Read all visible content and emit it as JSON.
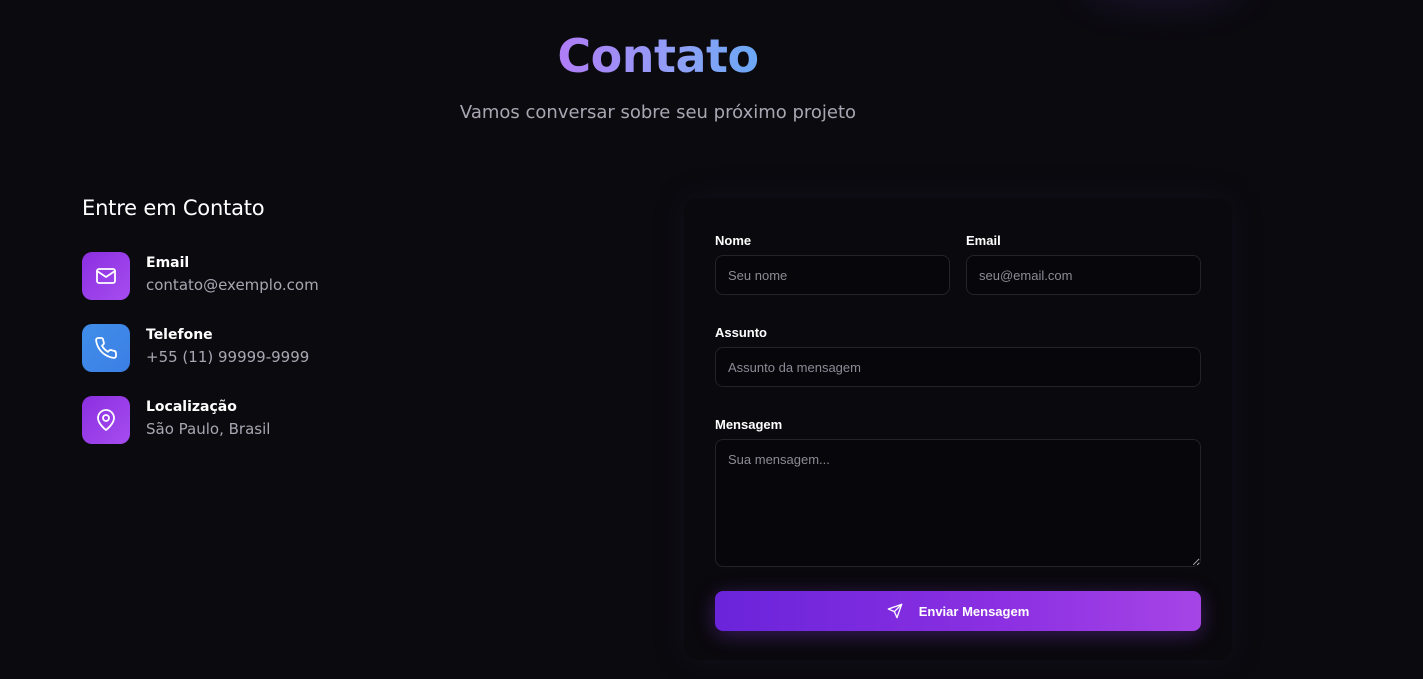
{
  "header": {
    "title": "Contato",
    "subtitle": "Vamos conversar sobre seu próximo projeto"
  },
  "contact_info": {
    "heading": "Entre em Contato",
    "items": [
      {
        "icon": "mail-icon",
        "label": "Email",
        "value": "contato@exemplo.com",
        "color": "#9b3ce8"
      },
      {
        "icon": "phone-icon",
        "label": "Telefone",
        "value": "+55 (11) 99999-9999",
        "color": "#3d87e7"
      },
      {
        "icon": "map-pin-icon",
        "label": "Localização",
        "value": "São Paulo, Brasil",
        "color": "#9b3ce8"
      }
    ]
  },
  "form": {
    "name": {
      "label": "Nome",
      "placeholder": "Seu nome"
    },
    "email": {
      "label": "Email",
      "placeholder": "seu@email.com"
    },
    "subject": {
      "label": "Assunto",
      "placeholder": "Assunto da mensagem"
    },
    "message": {
      "label": "Mensagem",
      "placeholder": "Sua mensagem..."
    },
    "submit_label": "Enviar Mensagem",
    "submit_icon": "send-icon"
  },
  "colors": {
    "background": "#0b0a0f",
    "accent_start": "#6a24da",
    "accent_end": "#a645e6",
    "title_gradient_start": "#b07cf6",
    "title_gradient_end": "#6aa8f5"
  }
}
